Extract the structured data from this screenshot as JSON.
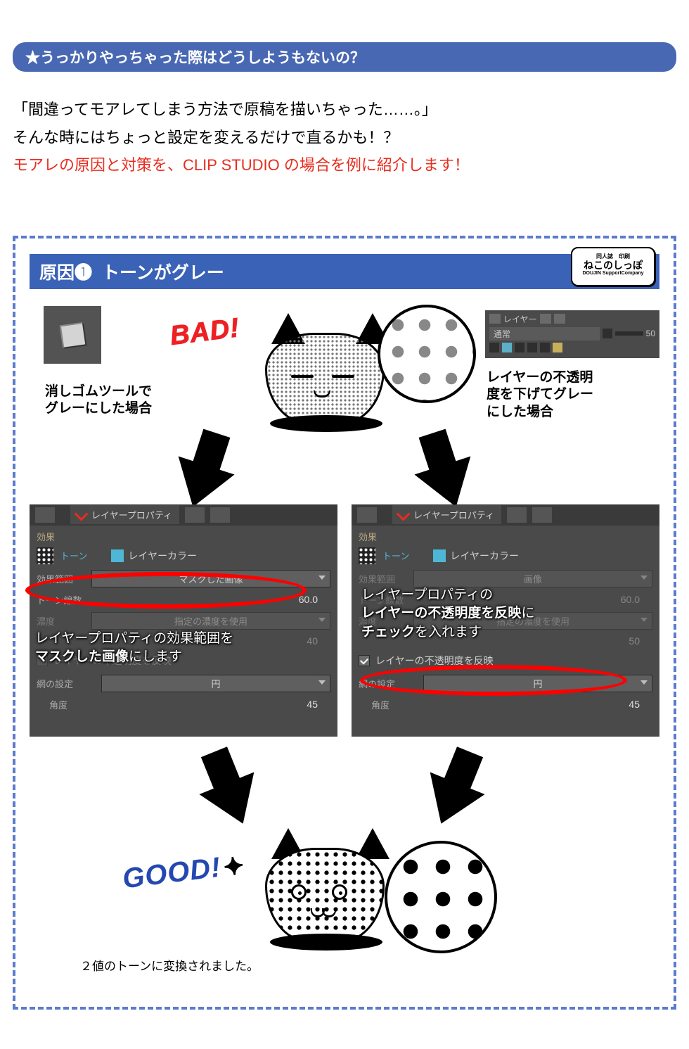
{
  "title_bar": "★うっかりやっちゃった際はどうしようもないの？",
  "intro": {
    "line1": "「間違ってモアレてしまう方法で原稿を描いちゃった……。」",
    "line2": "そんな時にはちょっと設定を変えるだけで直るかも！？",
    "line3_red": "モアレの原因と対策を、CLIP STUDIO の場合を例に紹介します！"
  },
  "box": {
    "header_label": "原因❶",
    "header_text": "トーンがグレー",
    "logo_top": "同人誌　印刷",
    "logo_main": "ねこのしっぽ",
    "logo_sub": "DOUJIN SupportCompany"
  },
  "upper": {
    "bad_label": "BAD!",
    "caption_left": "消しゴムツールで\nグレーにした場合",
    "caption_right": "レイヤーの不透明\n度を下げてグレー\nにした場合",
    "layer_panel": {
      "tab": "レイヤー",
      "blend": "通常",
      "opacity": "50"
    }
  },
  "panels": {
    "tab_title": "レイヤープロパティ",
    "section_effect": "効果",
    "tone_label": "トーン",
    "layer_color_label": "レイヤーカラー",
    "scope_label": "効果範囲",
    "lines_label": "トーン線数",
    "density_label": "濃度",
    "net_label": "網の設定",
    "angle_label": "角度",
    "left": {
      "scope_value": "マスクした画像",
      "lines_value": "60.0",
      "density_value": "指定の濃度を使用",
      "density_num": "40",
      "reflect_label": "レイヤーの不透明度を反映",
      "net_value": "円",
      "angle_value": "45",
      "overlay_pre": "レイヤープロパティの効果範囲を",
      "overlay_bold": "マスクした画像",
      "overlay_post": "にします"
    },
    "right": {
      "scope_value": "画像",
      "lines_value": "60.0",
      "density_value": "指定の濃度を使用",
      "density_num": "50",
      "reflect_label": "レイヤーの不透明度を反映",
      "net_value": "円",
      "angle_value": "45",
      "overlay_l1": "レイヤープロパティの",
      "overlay_b1": "レイヤーの不透明度を反映",
      "overlay_l2": "に",
      "overlay_b2": "チェック",
      "overlay_l3": "を入れます"
    }
  },
  "good": {
    "label": "GOOD!",
    "caption": "２値のトーンに変換されました。"
  }
}
